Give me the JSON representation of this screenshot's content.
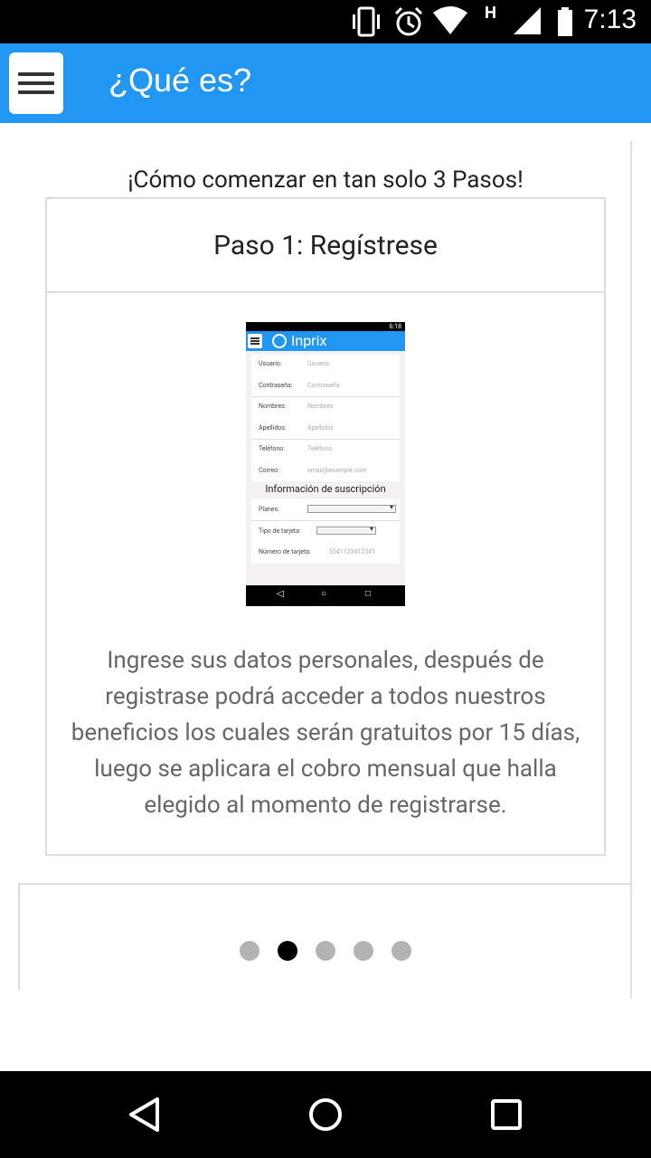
{
  "status_bar": {
    "time": "7:13",
    "network_label": "H",
    "icons": [
      "vibrate-icon",
      "alarm-icon",
      "wifi-icon",
      "signal-icon",
      "battery-icon"
    ]
  },
  "app_bar": {
    "title": "¿Qué es?",
    "color": "#2196f3"
  },
  "content": {
    "headline": "¡Cómo comenzar en tan solo 3 Pasos!",
    "card": {
      "title": "Paso 1: Regístrese",
      "description": "Ingrese sus datos personales, después de registrase podrá acceder a todos nuestros beneficios los cuales serán gratuitos por 15 días, luego se aplicara el cobro mensual que halla elegido al momento de registrarse."
    },
    "screenshot": {
      "time": "6:18",
      "brand": "Inprix",
      "fields": [
        {
          "label": "Usuario:",
          "value": "Usuario"
        },
        {
          "label": "Contraseña:",
          "value": "Contraseña"
        },
        {
          "label": "Nombres:",
          "value": "Nombres"
        },
        {
          "label": "Apellidos:",
          "value": "Apellidos"
        },
        {
          "label": "Teléfono:",
          "value": "Teléfono"
        },
        {
          "label": "Correo:",
          "value": "email@example.com"
        }
      ],
      "section_title": "Información de suscripción",
      "subscription_fields": [
        {
          "label": "Planes:"
        },
        {
          "label": "Tipo de tarjeta:"
        },
        {
          "label": "Número de tarjeta:",
          "value": "5541123412341"
        }
      ]
    },
    "pager": {
      "page_count": 5,
      "active_index": 1
    }
  },
  "nav_bar": {
    "buttons": [
      "back-icon",
      "home-icon",
      "recents-icon"
    ]
  }
}
